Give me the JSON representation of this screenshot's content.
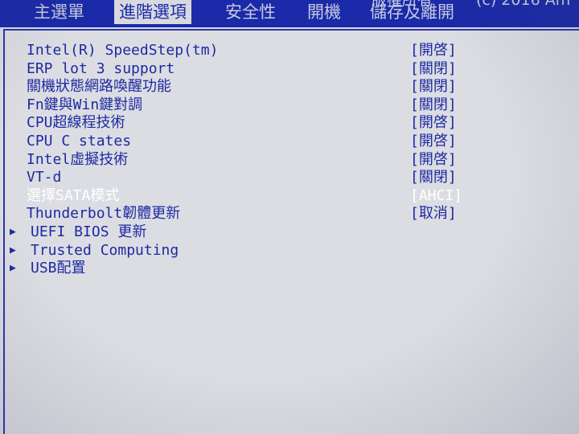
{
  "menu": {
    "tabs": [
      {
        "label": "主選單"
      },
      {
        "label": "進階選項"
      },
      {
        "label": "安全性"
      },
      {
        "label": "開機"
      },
      {
        "label": "儲存及離開"
      }
    ],
    "active_index": 1,
    "copyright_fragment": "(c) 2016 Am",
    "top_fragment": "版權所有"
  },
  "settings": [
    {
      "label": "Intel(R) SpeedStep(tm)",
      "value": "[開啓]",
      "submenu": false
    },
    {
      "label": "ERP lot 3 support",
      "value": "[關閉]",
      "submenu": false
    },
    {
      "label": "關機狀態網路喚醒功能",
      "value": "[關閉]",
      "submenu": false
    },
    {
      "label": "Fn鍵與Win鍵對調",
      "value": "[關閉]",
      "submenu": false
    },
    {
      "label": "CPU超線程技術",
      "value": "[開啓]",
      "submenu": false
    },
    {
      "label": "CPU C states",
      "value": "[開啓]",
      "submenu": false
    },
    {
      "label": "Intel虛擬技術",
      "value": "[開啓]",
      "submenu": false
    },
    {
      "label": "VT-d",
      "value": "[關閉]",
      "submenu": false
    },
    {
      "label": "選擇SATA模式",
      "value": "[AHCI]",
      "submenu": false,
      "selected": true
    },
    {
      "label": "Thunderbolt韌體更新",
      "value": "[取消]",
      "submenu": false
    },
    {
      "label": "UEFI BIOS 更新",
      "value": "",
      "submenu": true
    },
    {
      "label": "Trusted Computing",
      "value": "",
      "submenu": true
    },
    {
      "label": "USB配置",
      "value": "",
      "submenu": true
    }
  ],
  "colors": {
    "menubar": "#1a2aa8",
    "background": "#dcdde3",
    "text": "#1d2aa0",
    "selected_text": "#ffffff"
  },
  "icons": {
    "submenu": "triangle-right-icon"
  }
}
